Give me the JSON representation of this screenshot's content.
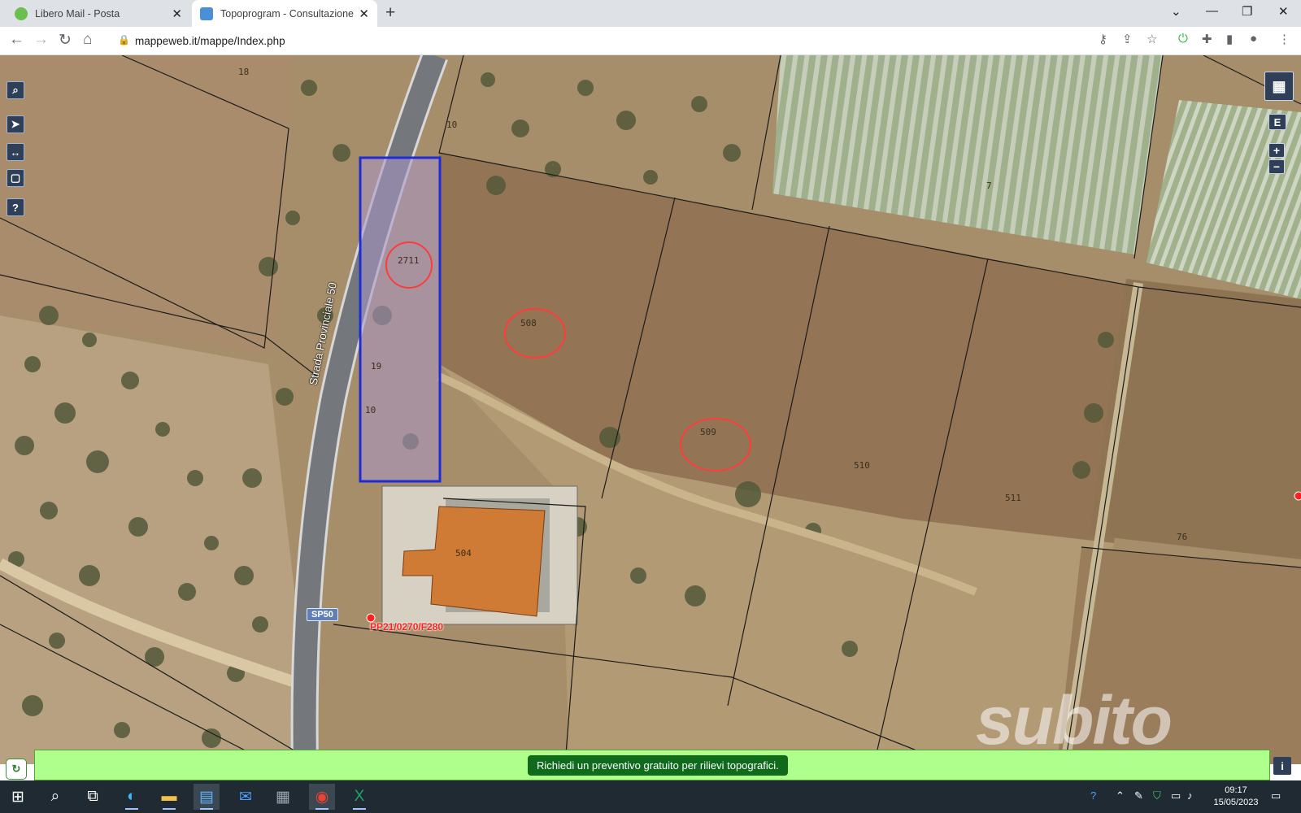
{
  "browser": {
    "tabs": [
      {
        "title": "Libero Mail - Posta",
        "favicon": "libero-leaf-icon",
        "active": false
      },
      {
        "title": "Topoprogram - Consultazione m",
        "favicon": "topoprogram-icon",
        "active": true
      }
    ],
    "new_tab": "+",
    "window_controls": {
      "list": "⌄",
      "minimize": "—",
      "maximize": "❐",
      "close": "✕"
    },
    "url": "mappeweb.it/mappe/Index.php",
    "colors": {
      "tabstrip": "#dee1e6",
      "toolbar": "#ffffff"
    }
  },
  "map": {
    "left_tools": [
      {
        "name": "search-icon",
        "glyph": "🔍"
      },
      {
        "name": "navigate-icon",
        "glyph": "➤"
      },
      {
        "name": "measure-icon",
        "glyph": "↔"
      },
      {
        "name": "select-area-icon",
        "glyph": "▢"
      },
      {
        "name": "help-icon",
        "glyph": "?"
      }
    ],
    "right_tools": {
      "layers": "🗺",
      "e": "E",
      "zoom_in": "+",
      "zoom_out": "−"
    },
    "parcels": [
      "18",
      "2711",
      "508",
      "509",
      "510",
      "511",
      "76",
      "7",
      "504",
      "10",
      "19",
      "10"
    ],
    "road_label": "Strada Provinciale 50",
    "road_badge": "SP50",
    "survey_point": "PP21/0270/F280",
    "watermark": "subito",
    "colors": {
      "highlight": "#1f2bd6",
      "building": "#cf7a35",
      "circle": "#ff3b3b"
    }
  },
  "promo": {
    "button": "Richiedi un preventivo gratuito per rilievi topografici.",
    "info": "i",
    "color": "#aeff8c"
  },
  "taskbar": {
    "clock_time": "09:17",
    "clock_date": "15/05/2023",
    "apps": [
      "windows-start-icon",
      "search-icon",
      "task-view-icon",
      "edge-icon",
      "file-explorer-icon",
      "store-icon",
      "mail-icon",
      "calculator-icon",
      "chrome-icon",
      "excel-icon"
    ]
  }
}
